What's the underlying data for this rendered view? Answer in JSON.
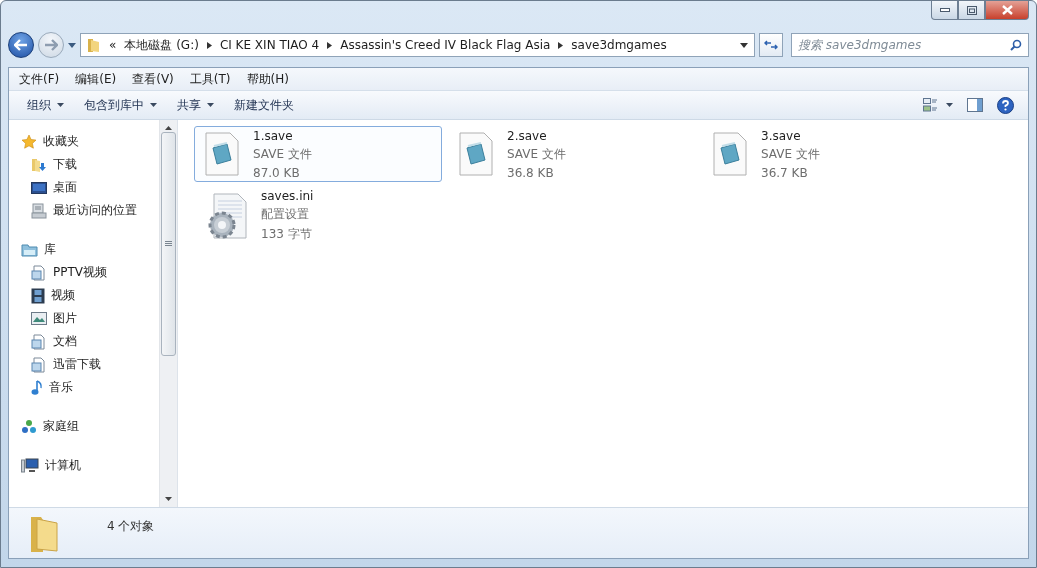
{
  "window": {
    "controls": [
      {
        "kind": "minimize"
      },
      {
        "kind": "maximize"
      },
      {
        "kind": "close"
      }
    ]
  },
  "address": {
    "overflow": "«",
    "crumbs": [
      "本地磁盘 (G:)",
      "CI KE XIN TIAO 4",
      "Assassin's Creed IV Black Flag Asia",
      "save3dmgames"
    ]
  },
  "search": {
    "placeholder": "搜索 save3dmgames"
  },
  "menu": [
    "文件(F)",
    "编辑(E)",
    "查看(V)",
    "工具(T)",
    "帮助(H)"
  ],
  "toolbar": [
    {
      "label": "组织",
      "dropdown": true
    },
    {
      "label": "包含到库中",
      "dropdown": true
    },
    {
      "label": "共享",
      "dropdown": true
    },
    {
      "label": "新建文件夹",
      "dropdown": false
    }
  ],
  "sidebar": [
    {
      "label": "收藏夹",
      "kind": "star",
      "children": [
        {
          "label": "下载",
          "kind": "download"
        },
        {
          "label": "桌面",
          "kind": "desktop"
        },
        {
          "label": "最近访问的位置",
          "kind": "recent"
        }
      ]
    },
    {
      "label": "库",
      "kind": "library",
      "children": [
        {
          "label": "PPTV视频",
          "kind": "doc"
        },
        {
          "label": "视频",
          "kind": "film"
        },
        {
          "label": "图片",
          "kind": "image"
        },
        {
          "label": "文档",
          "kind": "doc"
        },
        {
          "label": "迅雷下载",
          "kind": "doc"
        },
        {
          "label": "音乐",
          "kind": "music"
        }
      ]
    },
    {
      "label": "家庭组",
      "kind": "homegroup"
    },
    {
      "label": "计算机",
      "kind": "computer"
    }
  ],
  "files": [
    {
      "name": "1.save",
      "type": "SAVE 文件",
      "size": "87.0 KB",
      "kind": "save",
      "selected": true
    },
    {
      "name": "2.save",
      "type": "SAVE 文件",
      "size": "36.8 KB",
      "kind": "save",
      "selected": false
    },
    {
      "name": "3.save",
      "type": "SAVE 文件",
      "size": "36.7 KB",
      "kind": "save",
      "selected": false
    },
    {
      "name": "saves.ini",
      "type": "配置设置",
      "size": "133 字节",
      "kind": "settings",
      "selected": false
    }
  ],
  "status": {
    "count": "4 个对象"
  }
}
